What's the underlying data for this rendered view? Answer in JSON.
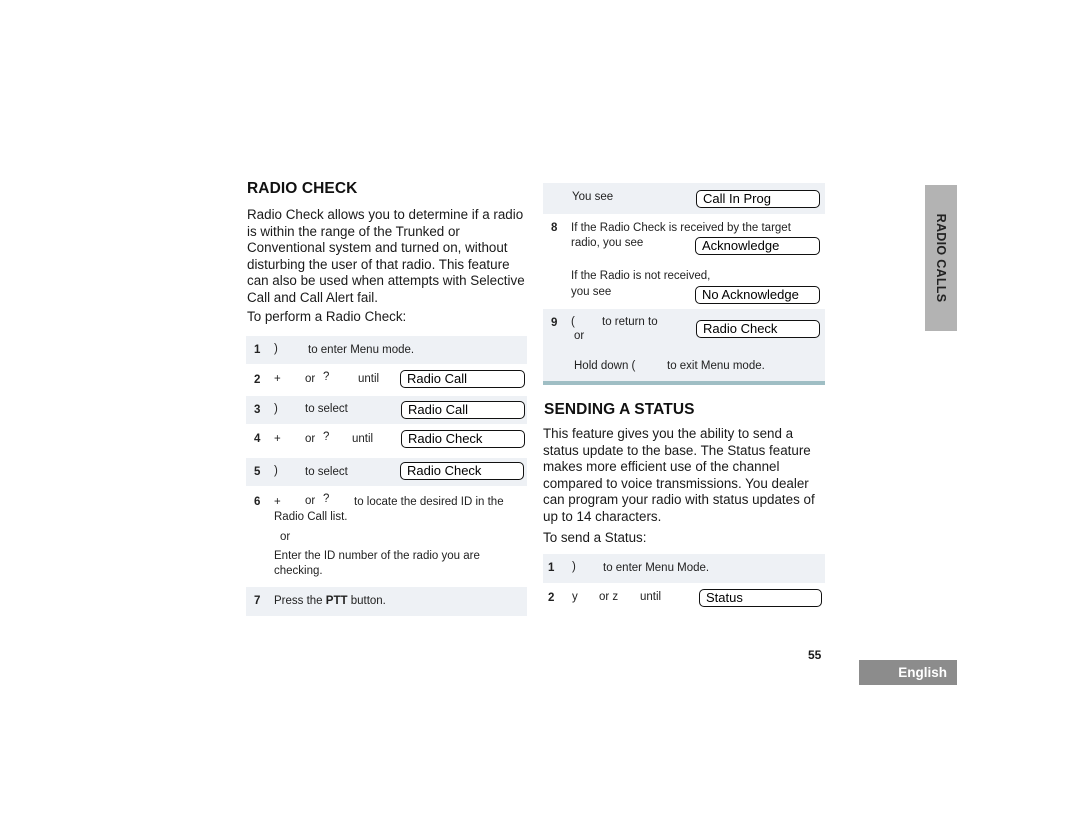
{
  "radio_check": {
    "title": "RADIO CHECK",
    "intro": "Radio Check allows you to determine if a radio is within the range of the Trunked or Conventional system and turned on, without disturbing the user of that radio. This feature can also be used when attempts with Selective Call and Call Alert fail.",
    "lead": "To perform a Radio Check:",
    "steps": [
      {
        "num": "1",
        "key": ")",
        "text": "to enter Menu mode.",
        "display": null
      },
      {
        "num": "2",
        "key": "+",
        "or": "or",
        "key2": "?",
        "text": "until",
        "display": "Radio Call"
      },
      {
        "num": "3",
        "key": ")",
        "text": "to select",
        "display": "Radio Call"
      },
      {
        "num": "4",
        "key": "+",
        "or": "or",
        "key2": "?",
        "text": "until",
        "display": "Radio Check"
      },
      {
        "num": "5",
        "key": ")",
        "text": "to select",
        "display": "Radio Check"
      },
      {
        "num": "6",
        "key": "+",
        "or": "or",
        "key2": "?",
        "text": "to locate the desired ID in the",
        "text2": "Radio Call list.",
        "alt_or": "or",
        "alt_text": "Enter the ID number of the radio you are checking."
      },
      {
        "num": "7",
        "text_pre": "Press the ",
        "text_bold": "PTT",
        "text_post": " button."
      }
    ],
    "continued": [
      {
        "label": "You see",
        "display": "Call In Prog"
      },
      {
        "num": "8",
        "text": "If the Radio Check is received by the target",
        "text2": "radio, you see",
        "display": "Acknowledge",
        "alt_text": "If the Radio is not received,",
        "alt_text2": "you see",
        "alt_display": "No Acknowledge"
      },
      {
        "num": "9",
        "key": "(",
        "text": "to return to",
        "or": "or",
        "display": "Radio Check",
        "alt_text_pre": "Hold down (",
        "alt_text_post": "to exit Menu mode."
      }
    ]
  },
  "sending_status": {
    "title": "SENDING A STATUS",
    "intro": "This feature gives you the ability to send a status update to the base. The Status feature makes more efficient use of the channel compared to voice transmissions. You dealer can program your radio with status updates of up to 14 characters.",
    "lead": "To send a Status:",
    "steps": [
      {
        "num": "1",
        "key": ")",
        "text": "to enter Menu Mode."
      },
      {
        "num": "2",
        "key": "y",
        "or": "or z",
        "text": "until",
        "display": "Status"
      }
    ]
  },
  "side_tab": "RADIO CALLS",
  "page_number": "55",
  "language_tab": "English"
}
